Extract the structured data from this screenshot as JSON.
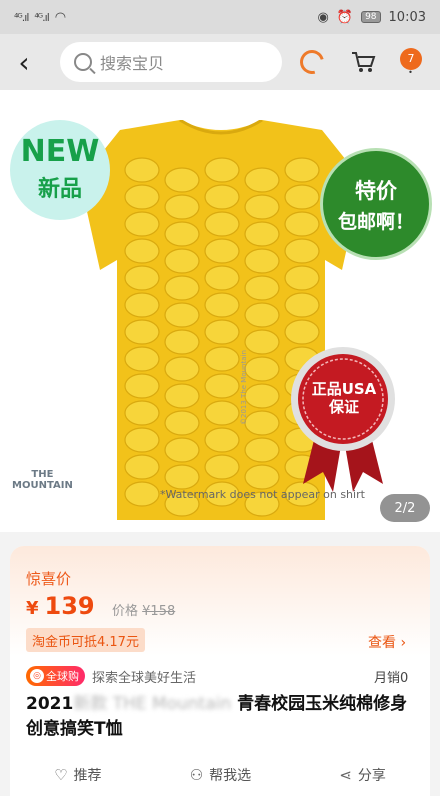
{
  "status_bar": {
    "time": "10:03",
    "battery": "98",
    "signal1": "⁴ᴳ.ıl",
    "signal2": "⁴ᴳ.ıl"
  },
  "nav": {
    "search_placeholder": "搜索宝贝",
    "cart_badge": "7"
  },
  "hero": {
    "new_en": "NEW",
    "new_cn": "新品",
    "promo_line1": "特价",
    "promo_line2": "包邮啊！",
    "seal_line1": "正品USA",
    "seal_line2": "保证",
    "brand_line1": "THE",
    "brand_line2": "MOUNTAIN",
    "watermark": "*Watermark does not appear on shirt",
    "copyright": "©2013 The Mountain",
    "pager": "2/2"
  },
  "product": {
    "deal_label": "惊喜价",
    "currency": "¥",
    "price": "139",
    "orig_label": "价格",
    "orig_price": "¥158",
    "coin_text": "淘金币可抵4.17元",
    "view_label": "查看 ›",
    "global_badge": "全球购",
    "global_text": "探索全球美好生活",
    "sales": "月销0",
    "title_start": "2021",
    "title_blur": "新款 THE Mountain",
    "title_end": " 青春校园玉米纯棉修身创意搞笑T恤"
  },
  "actions": {
    "recommend": "推荐",
    "help_choose": "帮我选",
    "share": "分享"
  },
  "colors": {
    "accent": "#ee5a1b",
    "price": "#ee4a0f",
    "corn": "#f2c21a"
  }
}
